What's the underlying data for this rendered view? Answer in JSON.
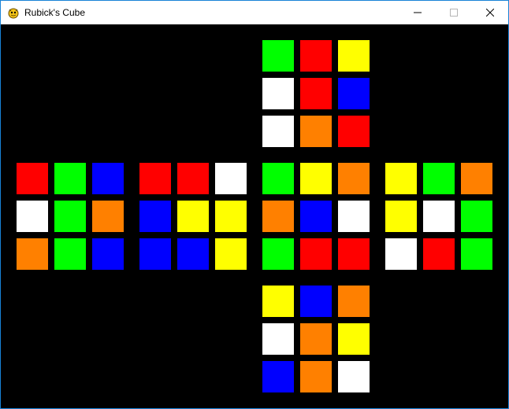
{
  "window": {
    "title": "Rubick's Cube",
    "icon": "pygame-snake-icon"
  },
  "controls": {
    "minimize_icon": "minimize-icon",
    "maximize_icon": "maximize-icon",
    "close_icon": "close-icon"
  },
  "colors": {
    "G": "#00ff00",
    "R": "#ff0000",
    "Y": "#ffff00",
    "W": "#ffffff",
    "B": "#0000ff",
    "O": "#ff8000"
  },
  "cube": {
    "top": [
      [
        "G",
        "R",
        "Y"
      ],
      [
        "W",
        "R",
        "B"
      ],
      [
        "W",
        "O",
        "R"
      ]
    ],
    "left": [
      [
        "R",
        "G",
        "B"
      ],
      [
        "W",
        "G",
        "O"
      ],
      [
        "O",
        "G",
        "B"
      ]
    ],
    "back": [
      [
        "R",
        "R",
        "W"
      ],
      [
        "B",
        "Y",
        "Y"
      ],
      [
        "B",
        "B",
        "Y"
      ]
    ],
    "front": [
      [
        "G",
        "Y",
        "O"
      ],
      [
        "O",
        "B",
        "W"
      ],
      [
        "G",
        "R",
        "R"
      ]
    ],
    "right": [
      [
        "Y",
        "G",
        "O"
      ],
      [
        "Y",
        "W",
        "G"
      ],
      [
        "W",
        "R",
        "G"
      ]
    ],
    "bottom": [
      [
        "Y",
        "B",
        "O"
      ],
      [
        "W",
        "O",
        "Y"
      ],
      [
        "B",
        "O",
        "W"
      ]
    ]
  }
}
